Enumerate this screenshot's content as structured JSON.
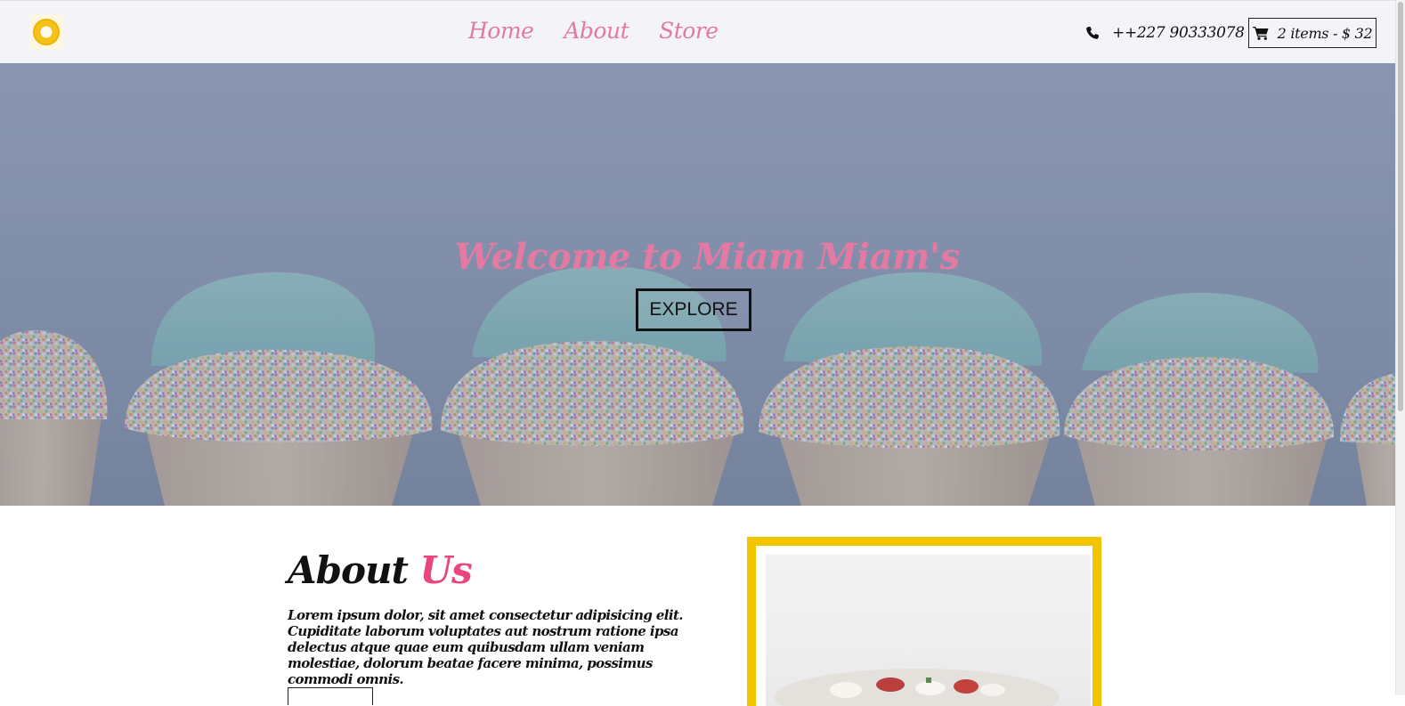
{
  "navbar": {
    "logo_icon": "ring-logo-icon",
    "links": [
      "Home",
      "About",
      "Store"
    ],
    "phone": "++227 90333078",
    "phone_icon": "phone-icon",
    "cart_label": "2 items - $ 32",
    "cart_icon": "cart-icon"
  },
  "hero": {
    "title": "Welcome to Miam Miam's",
    "button": "EXPLORE"
  },
  "about": {
    "heading_main": "About",
    "heading_accent": "Us",
    "text": "Lorem ipsum dolor, sit amet consectetur adipisicing elit. Cupiditate laborum voluptates aut nostrum ratione ipsa delectus atque quae eum quibusdam ullam veniam molestiae, dolorum beatae facere minima, possimus commodi omnis."
  },
  "colors": {
    "accent_pink": "#e27aa2",
    "accent_strong_pink": "#e8467c",
    "frame_yellow": "#f2c500",
    "nav_bg": "#f4f4f8"
  }
}
